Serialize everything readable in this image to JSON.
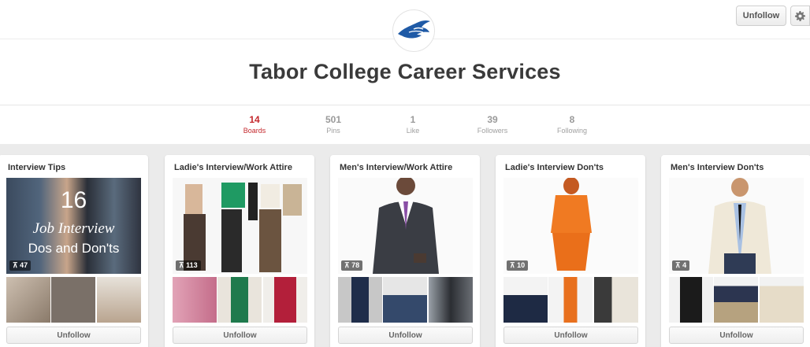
{
  "profile": {
    "name": "Tabor College Career Services",
    "unfollow_label": "Unfollow"
  },
  "stats": [
    {
      "value": "14",
      "label": "Boards",
      "active": true
    },
    {
      "value": "501",
      "label": "Pins",
      "active": false
    },
    {
      "value": "1",
      "label": "Like",
      "active": false
    },
    {
      "value": "39",
      "label": "Followers",
      "active": false
    },
    {
      "value": "8",
      "label": "Following",
      "active": false
    }
  ],
  "boards": [
    {
      "title": "Interview Tips",
      "pin_count": "47",
      "cover_text": [
        "16",
        "Job Interview",
        "Dos and Don'ts"
      ],
      "button": "Unfollow"
    },
    {
      "title": "Ladie's Interview/Work Attire",
      "pin_count": "113",
      "button": "Unfollow"
    },
    {
      "title": "Men's Interview/Work Attire",
      "pin_count": "78",
      "button": "Unfollow"
    },
    {
      "title": "Ladie's Interview Don'ts",
      "pin_count": "10",
      "button": "Unfollow"
    },
    {
      "title": "Men's Interview Don'ts",
      "pin_count": "4",
      "button": "Unfollow"
    }
  ],
  "colors": {
    "accent": "#c4282d",
    "logo_blue": "#1f5aa6"
  },
  "icons": [
    "gear-icon",
    "pin-icon",
    "tabor-bluejay-logo"
  ]
}
